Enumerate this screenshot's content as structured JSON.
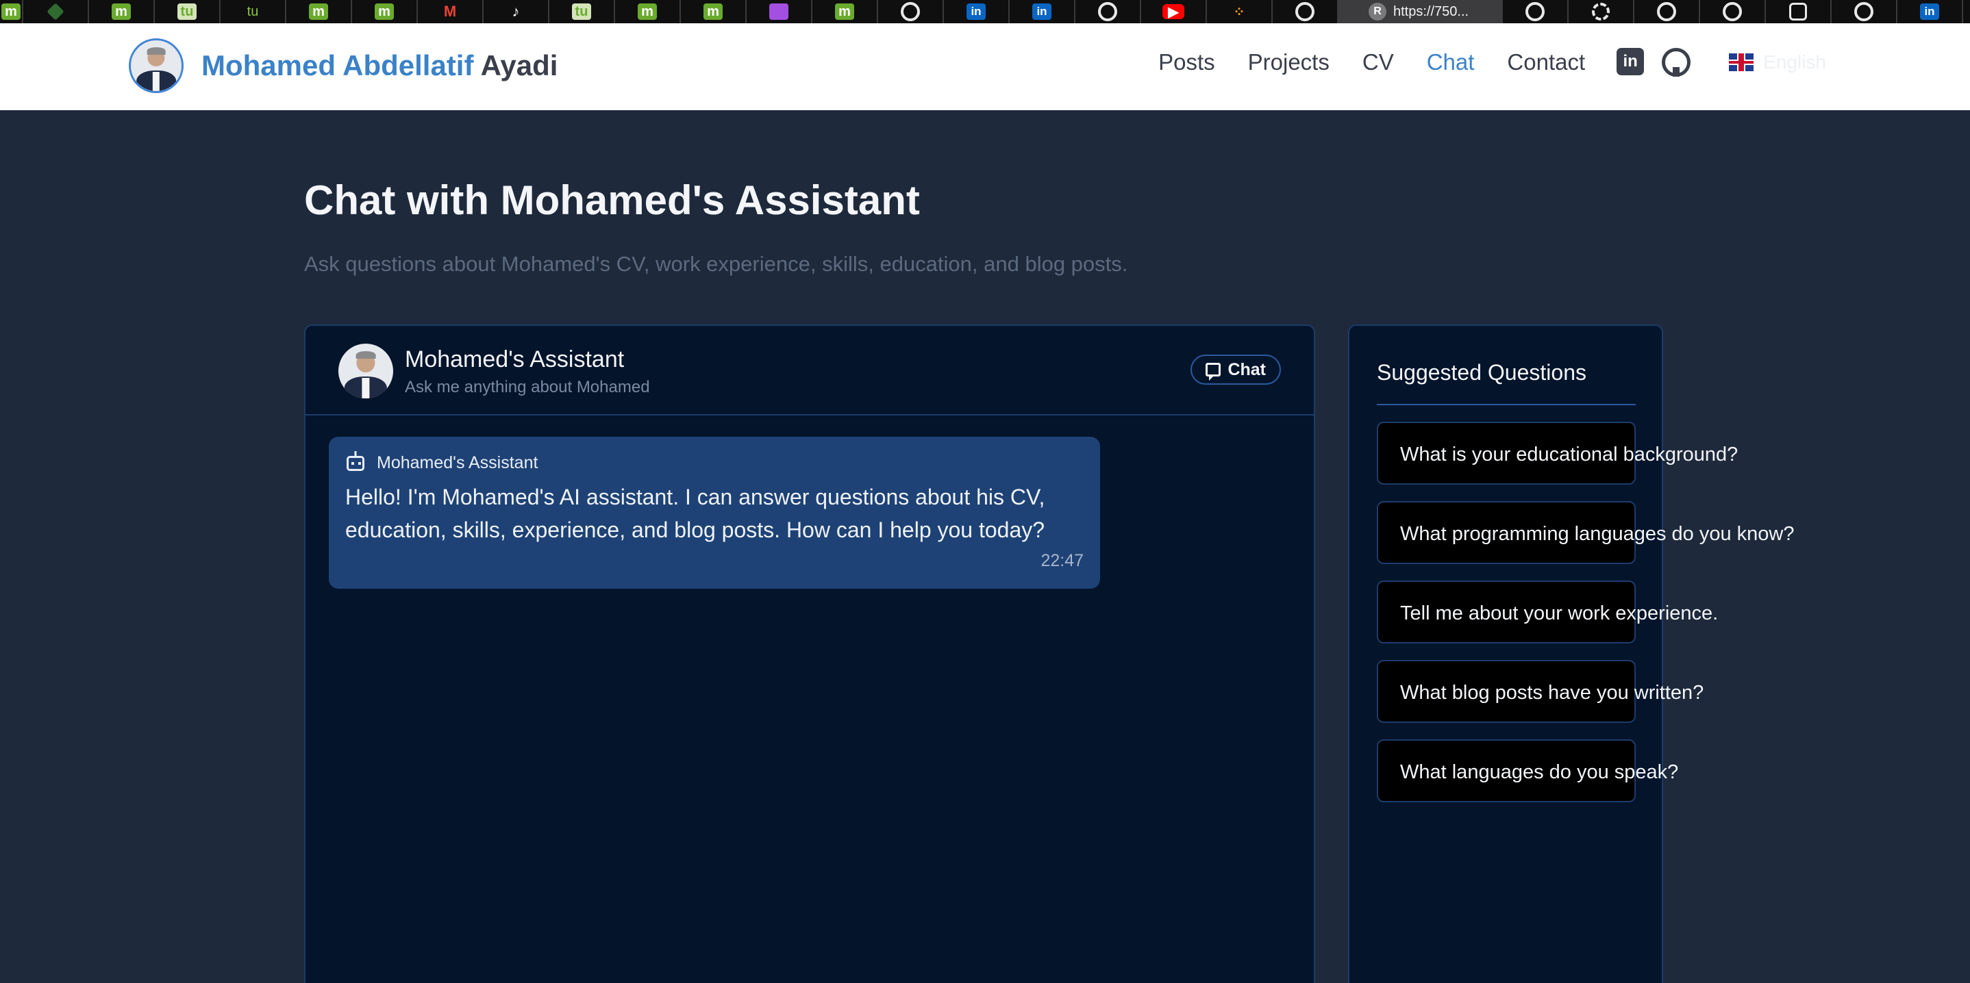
{
  "browser": {
    "active_tab_title": "https://750...",
    "active_tab_letter": "R",
    "tabs": [
      {
        "icon": "medium-icon",
        "letter": "m",
        "style": "m"
      },
      {
        "icon": "green-diamond-icon",
        "letter": "",
        "style": "gr"
      },
      {
        "icon": "medium-icon",
        "letter": "m",
        "style": "m"
      },
      {
        "icon": "tu-icon",
        "letter": "tu",
        "style": "tu"
      },
      {
        "icon": "tu-icon",
        "letter": "tu",
        "style": "tul"
      },
      {
        "icon": "medium-icon",
        "letter": "m",
        "style": "m"
      },
      {
        "icon": "medium-icon",
        "letter": "m",
        "style": "m"
      },
      {
        "icon": "gmail-icon",
        "letter": "M",
        "style": "gm"
      },
      {
        "icon": "tiktok-icon",
        "letter": "♪",
        "style": "tk"
      },
      {
        "icon": "tu-icon",
        "letter": "tu",
        "style": "tu"
      },
      {
        "icon": "medium-icon",
        "letter": "m",
        "style": "m"
      },
      {
        "icon": "medium-icon",
        "letter": "m",
        "style": "m"
      },
      {
        "icon": "purple-app-icon",
        "letter": "",
        "style": "pu"
      },
      {
        "icon": "medium-icon",
        "letter": "m",
        "style": "m"
      },
      {
        "icon": "github-icon",
        "letter": "",
        "style": "gh"
      },
      {
        "icon": "linkedin-icon",
        "letter": "in",
        "style": "li"
      },
      {
        "icon": "linkedin-icon",
        "letter": "in",
        "style": "li"
      },
      {
        "icon": "github-icon",
        "letter": "",
        "style": "gh"
      },
      {
        "icon": "youtube-icon",
        "letter": "▶",
        "style": "yt"
      },
      {
        "icon": "dots-icon",
        "letter": "⁘",
        "style": "dk"
      },
      {
        "icon": "github-icon",
        "letter": "",
        "style": "gh"
      }
    ],
    "tabs_after": [
      {
        "icon": "github-icon",
        "letter": "",
        "style": "gh"
      },
      {
        "icon": "spiral-icon",
        "letter": "",
        "style": "sp"
      },
      {
        "icon": "github-icon",
        "letter": "",
        "style": "gh"
      },
      {
        "icon": "github-icon",
        "letter": "",
        "style": "gh"
      },
      {
        "icon": "openai-icon",
        "letter": "",
        "style": "ai"
      },
      {
        "icon": "github-icon",
        "letter": "",
        "style": "gh"
      },
      {
        "icon": "linkedin-icon",
        "letter": "in",
        "style": "li"
      }
    ]
  },
  "header": {
    "brand_first": "Mohamed Abdellatif",
    "brand_last": "Ayadi",
    "nav": [
      "Posts",
      "Projects",
      "CV",
      "Chat",
      "Contact"
    ],
    "active_nav": "Chat",
    "linkedin_label": "in",
    "language": "English"
  },
  "main": {
    "title": "Chat with Mohamed's Assistant",
    "subtitle": "Ask questions about Mohamed's CV, work experience, skills, education, and blog posts."
  },
  "chat": {
    "assistant_name": "Mohamed's Assistant",
    "assistant_sub": "Ask me anything about Mohamed",
    "badge_label": "Chat",
    "messages": [
      {
        "sender": "Mohamed's Assistant",
        "text": "Hello! I'm Mohamed's AI assistant. I can answer questions about his CV, education, skills, experience, and blog posts. How can I help you today?",
        "time": "22:47"
      }
    ]
  },
  "suggestions": {
    "title": "Suggested Questions",
    "items": [
      "What is your educational background?",
      "What programming languages do you know?",
      "Tell me about your work experience.",
      "What blog posts have you written?",
      "What languages do you speak?"
    ]
  },
  "colors": {
    "accent": "#3b82c8",
    "page_bg": "#1e293b",
    "panel_bg": "#04142b",
    "message_bg": "#1e4275"
  }
}
